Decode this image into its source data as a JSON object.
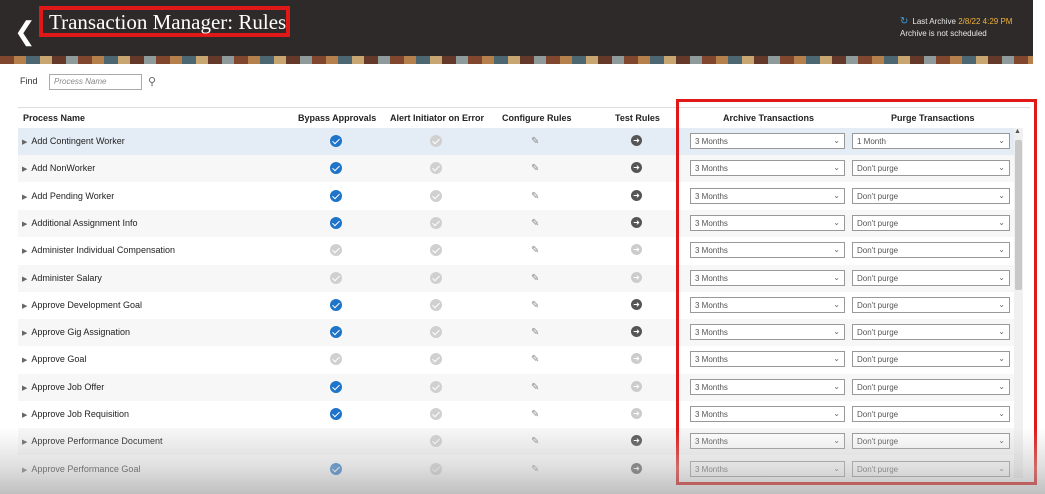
{
  "header": {
    "title": "Transaction Manager: Rules",
    "last_archive_label": "Last Archive",
    "last_archive_date": "2/8/22 4:29 PM",
    "archive_schedule": "Archive is not scheduled"
  },
  "search": {
    "label": "Find",
    "placeholder": "Process Name"
  },
  "columns": {
    "process_name": "Process Name",
    "bypass_approvals": "Bypass Approvals",
    "alert_initiator": "Alert Initiator on Error",
    "configure_rules": "Configure Rules",
    "test_rules": "Test Rules",
    "archive_transactions": "Archive Transactions",
    "purge_transactions": "Purge Transactions"
  },
  "rows": [
    {
      "name": "Add Contingent Worker",
      "bypass": true,
      "test": true,
      "archive": "3 Months",
      "purge": "1 Month"
    },
    {
      "name": "Add NonWorker",
      "bypass": true,
      "test": true,
      "archive": "3 Months",
      "purge": "Don't purge"
    },
    {
      "name": "Add Pending Worker",
      "bypass": true,
      "test": true,
      "archive": "3 Months",
      "purge": "Don't purge"
    },
    {
      "name": "Additional Assignment Info",
      "bypass": true,
      "test": true,
      "archive": "3 Months",
      "purge": "Don't purge"
    },
    {
      "name": "Administer Individual Compensation",
      "bypass": false,
      "test": false,
      "archive": "3 Months",
      "purge": "Don't purge"
    },
    {
      "name": "Administer Salary",
      "bypass": false,
      "test": false,
      "archive": "3 Months",
      "purge": "Don't purge"
    },
    {
      "name": "Approve Development Goal",
      "bypass": true,
      "test": true,
      "archive": "3 Months",
      "purge": "Don't purge"
    },
    {
      "name": "Approve Gig Assignation",
      "bypass": true,
      "test": true,
      "archive": "3 Months",
      "purge": "Don't purge"
    },
    {
      "name": "Approve Goal",
      "bypass": false,
      "test": false,
      "archive": "3 Months",
      "purge": "Don't purge"
    },
    {
      "name": "Approve Job Offer",
      "bypass": true,
      "test": false,
      "archive": "3 Months",
      "purge": "Don't purge"
    },
    {
      "name": "Approve Job Requisition",
      "bypass": true,
      "test": false,
      "archive": "3 Months",
      "purge": "Don't purge"
    },
    {
      "name": "Approve Performance Document",
      "bypass": null,
      "test": true,
      "archive": "3 Months",
      "purge": "Don't purge"
    },
    {
      "name": "Approve Performance Goal",
      "bypass": true,
      "test": true,
      "archive": "3 Months",
      "purge": "Don't purge"
    }
  ],
  "colors": {
    "accent": "#1e74c8",
    "highlight": "#e01818",
    "header_bg": "#2e2a29",
    "archive_date": "#f0b33a"
  },
  "icons": {
    "back": "chevron-left-icon",
    "search": "search-icon",
    "refresh": "refresh-icon",
    "check": "check-circle-icon",
    "edit": "pencil-icon",
    "test": "arrow-right-circle-icon"
  }
}
